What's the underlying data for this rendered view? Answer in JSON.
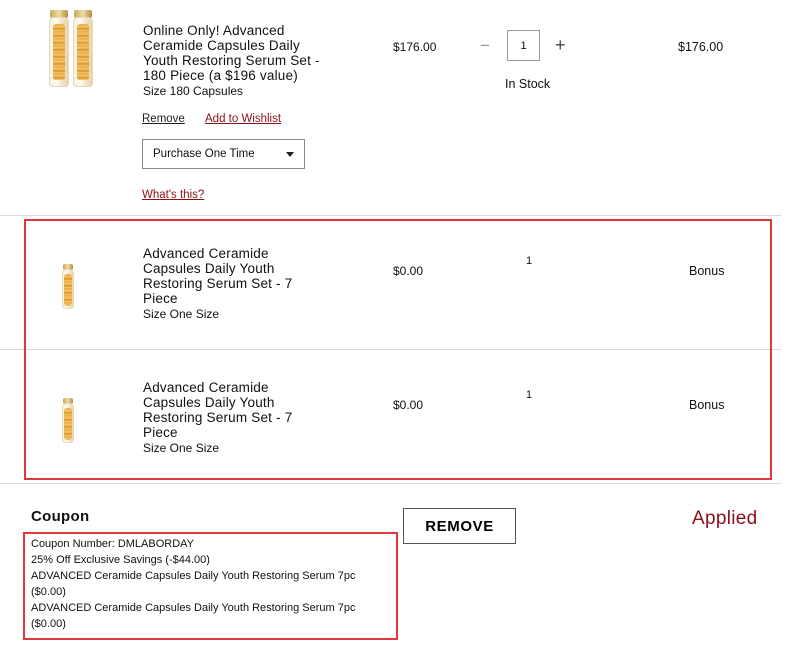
{
  "colors": {
    "accent_red": "#8b0f17",
    "highlight_border": "#e2373b"
  },
  "items": [
    {
      "title_lines": [
        "Online Only! Advanced",
        "Ceramide Capsules Daily",
        "Youth Restoring Serum Set -",
        "180 Piece (a $196 value)"
      ],
      "size_text": "Size 180 Capsules",
      "unit_price": "$176.00",
      "quantity": "1",
      "stock_status": "In Stock",
      "line_total": "$176.00",
      "remove_label": "Remove",
      "wishlist_label": "Add to Wishlist",
      "purchase_option": "Purchase One Time",
      "whats_this_label": "What's this?",
      "thumbnail_icon": "serum-capsule-bottles-icon"
    },
    {
      "title_lines": [
        "Advanced Ceramide",
        "Capsules Daily Youth",
        "Restoring Serum Set - 7",
        "Piece"
      ],
      "size_text": "Size One Size",
      "unit_price": "$0.00",
      "quantity": "1",
      "line_total": "Bonus",
      "thumbnail_icon": "serum-capsule-vial-icon"
    },
    {
      "title_lines": [
        "Advanced Ceramide",
        "Capsules Daily Youth",
        "Restoring Serum Set - 7",
        "Piece"
      ],
      "size_text": "Size One Size",
      "unit_price": "$0.00",
      "quantity": "1",
      "line_total": "Bonus",
      "thumbnail_icon": "serum-capsule-vial-icon"
    }
  ],
  "coupon": {
    "heading": "Coupon",
    "remove_button_label": "REMOVE",
    "status": "Applied",
    "details": [
      "Coupon Number: DMLABORDAY",
      "25% Off Exclusive Savings (-$44.00)",
      "ADVANCED Ceramide Capsules Daily Youth Restoring Serum 7pc",
      "($0.00)",
      "ADVANCED Ceramide Capsules Daily Youth Restoring Serum 7pc",
      "($0.00)"
    ]
  },
  "quantity_controls": {
    "minus_symbol": "−",
    "plus_symbol": "+"
  }
}
